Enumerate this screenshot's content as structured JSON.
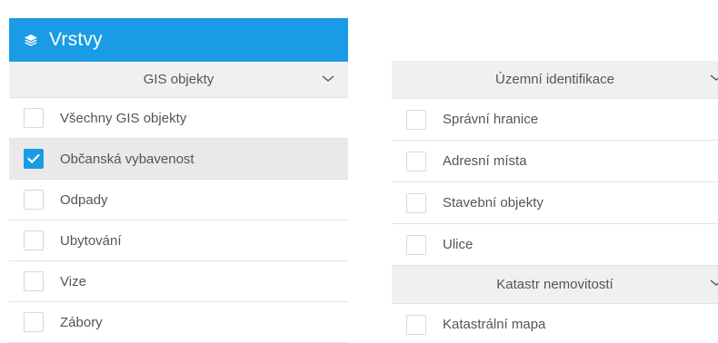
{
  "header": {
    "title": "Vrstvy",
    "icon": "layers-icon",
    "color": "#1a9be6"
  },
  "left_section": {
    "title": "GIS objekty",
    "items": [
      {
        "label": "Všechny GIS objekty",
        "checked": false
      },
      {
        "label": "Občanská vybavenost",
        "checked": true
      },
      {
        "label": "Odpady",
        "checked": false
      },
      {
        "label": "Ubytování",
        "checked": false
      },
      {
        "label": "Vize",
        "checked": false
      },
      {
        "label": "Zábory",
        "checked": false
      }
    ]
  },
  "right_sections": [
    {
      "title": "Územní identifikace",
      "items": [
        {
          "label": "Správní hranice",
          "checked": false
        },
        {
          "label": "Adresní místa",
          "checked": false
        },
        {
          "label": "Stavební objekty",
          "checked": false
        },
        {
          "label": "Ulice",
          "checked": false
        }
      ]
    },
    {
      "title": "Katastr nemovitostí",
      "items": [
        {
          "label": "Katastrální mapa",
          "checked": false
        }
      ]
    }
  ]
}
